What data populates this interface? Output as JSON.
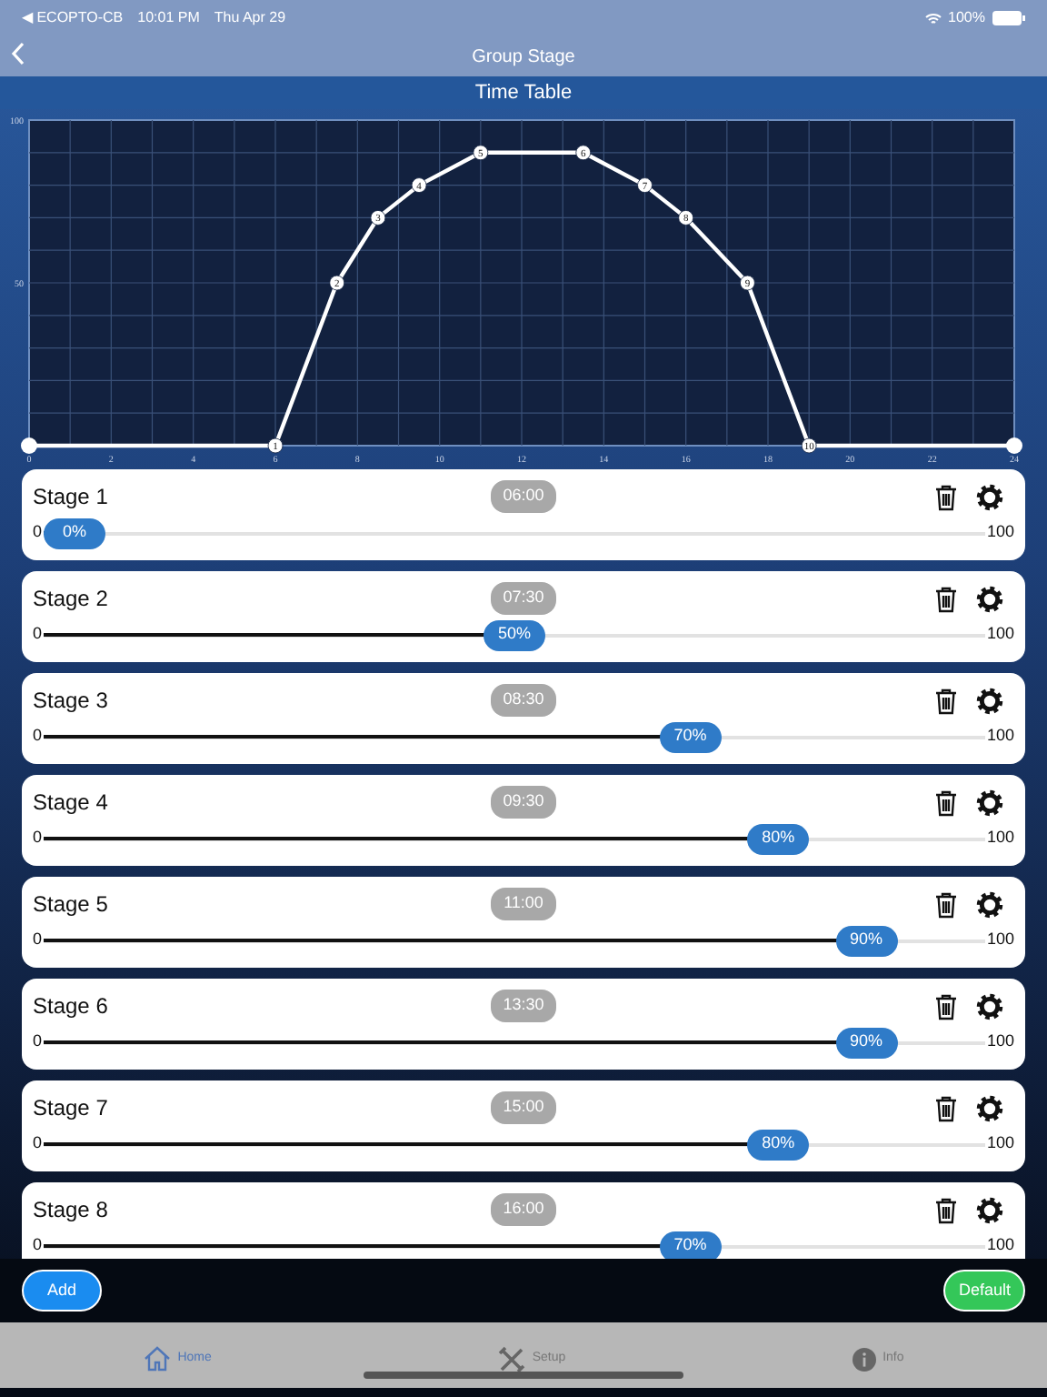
{
  "status_bar": {
    "back_app": "◀ ECOPTO-CB",
    "time": "10:01 PM",
    "date": "Thu Apr 29",
    "battery": "100%"
  },
  "nav": {
    "title": "Group Stage"
  },
  "section_title": "Time Table",
  "chart_data": {
    "type": "line",
    "xlim": [
      0,
      24
    ],
    "ylim": [
      0,
      100
    ],
    "xticks": [
      0,
      2,
      4,
      6,
      8,
      10,
      12,
      14,
      16,
      18,
      20,
      22,
      24
    ],
    "yticks": [
      50,
      100
    ],
    "grid": true,
    "series": [
      {
        "marker": "circle",
        "color": "#ffffff",
        "x": [
          0,
          6,
          7.5,
          8.5,
          9.5,
          11,
          13.5,
          15,
          16,
          17.5,
          19,
          24
        ],
        "values": [
          0,
          0,
          50,
          70,
          80,
          90,
          90,
          80,
          70,
          50,
          0,
          0
        ]
      }
    ],
    "annotations": [
      {
        "x": 6,
        "y": 0,
        "text": "1"
      },
      {
        "x": 7.5,
        "y": 50,
        "text": "2"
      },
      {
        "x": 8.5,
        "y": 70,
        "text": "3"
      },
      {
        "x": 9.5,
        "y": 80,
        "text": "4"
      },
      {
        "x": 11,
        "y": 90,
        "text": "5"
      },
      {
        "x": 13.5,
        "y": 90,
        "text": "6"
      },
      {
        "x": 15,
        "y": 80,
        "text": "7"
      },
      {
        "x": 16,
        "y": 70,
        "text": "8"
      },
      {
        "x": 17.5,
        "y": 50,
        "text": "9"
      },
      {
        "x": 19,
        "y": 0,
        "text": "10"
      }
    ]
  },
  "stages": [
    {
      "name": "Stage 1",
      "time": "06:00",
      "min": "0",
      "max": "100",
      "level": 0,
      "reading": "0%"
    },
    {
      "name": "Stage 2",
      "time": "07:30",
      "min": "0",
      "max": "100",
      "level": 0.5,
      "reading": "50%"
    },
    {
      "name": "Stage 3",
      "time": "08:30",
      "min": "0",
      "max": "100",
      "level": 0.7,
      "reading": "70%"
    },
    {
      "name": "Stage 4",
      "time": "09:30",
      "min": "0",
      "max": "100",
      "level": 0.8,
      "reading": "80%"
    },
    {
      "name": "Stage 5",
      "time": "11:00",
      "min": "0",
      "max": "100",
      "level": 0.9,
      "reading": "90%"
    },
    {
      "name": "Stage 6",
      "time": "13:30",
      "min": "0",
      "max": "100",
      "level": 0.9,
      "reading": "90%"
    },
    {
      "name": "Stage 7",
      "time": "15:00",
      "min": "0",
      "max": "100",
      "level": 0.8,
      "reading": "80%"
    },
    {
      "name": "Stage 8",
      "time": "16:00",
      "min": "0",
      "max": "100",
      "level": 0.7,
      "reading": "70%"
    }
  ],
  "buttons": {
    "add": "Add",
    "default": "Default"
  },
  "tab_bar": [
    {
      "label": "Home",
      "kind": "home",
      "selected": true
    },
    {
      "label": "Setup",
      "kind": "setup",
      "selected": false
    },
    {
      "label": "Info",
      "kind": "info",
      "selected": false
    }
  ]
}
